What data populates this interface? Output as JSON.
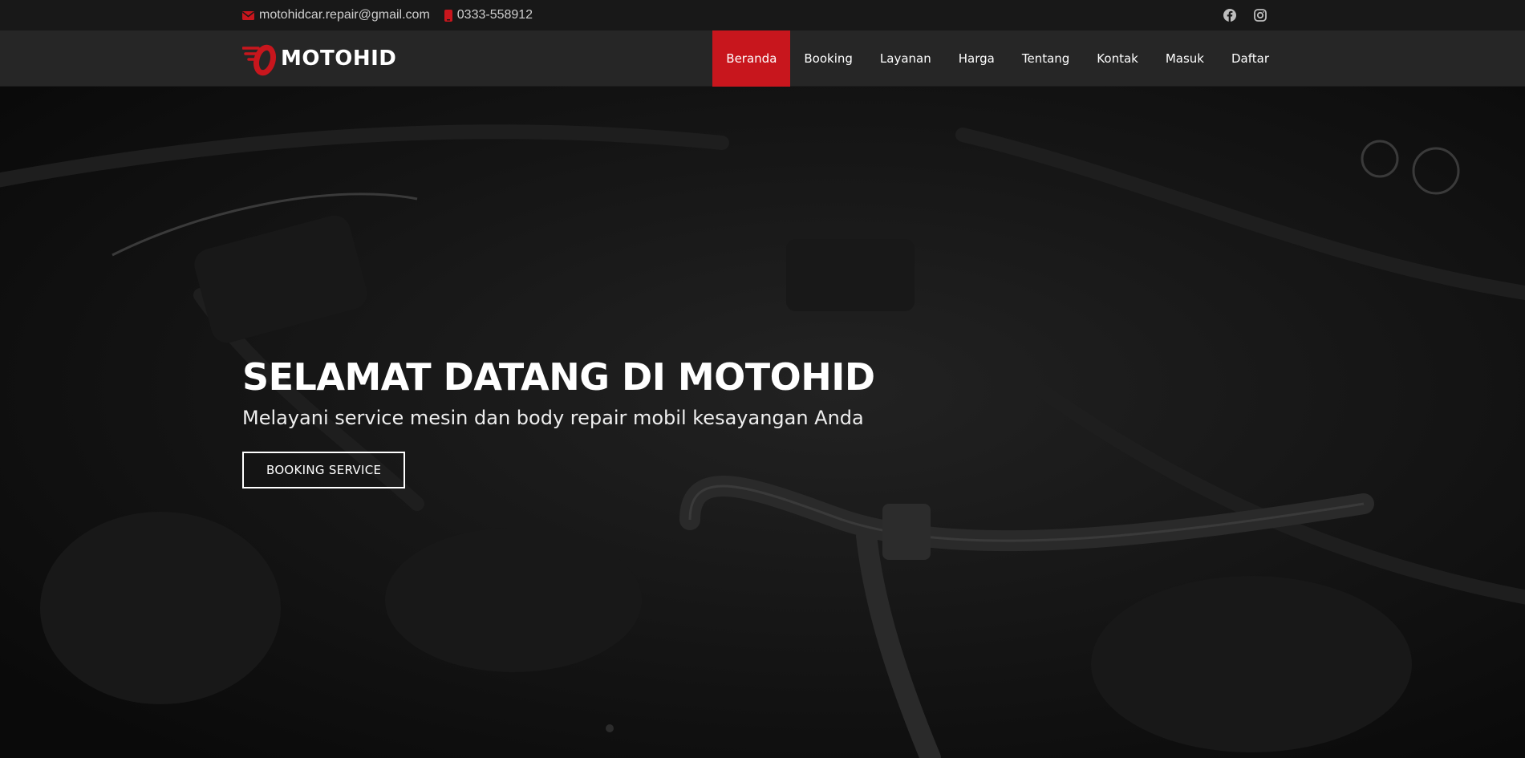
{
  "topbar": {
    "email": "motohidcar.repair@gmail.com",
    "phone": "0333-558912",
    "social": [
      "facebook-icon",
      "instagram-icon"
    ]
  },
  "brand": {
    "name": "MOTOHID",
    "accent": "#c8161d"
  },
  "nav": {
    "items": [
      {
        "label": "Beranda",
        "active": true
      },
      {
        "label": "Booking"
      },
      {
        "label": "Layanan"
      },
      {
        "label": "Harga"
      },
      {
        "label": "Tentang"
      },
      {
        "label": "Kontak"
      },
      {
        "label": "Masuk"
      },
      {
        "label": "Daftar"
      }
    ]
  },
  "hero": {
    "title": "SELAMAT DATANG DI MOTOHID",
    "subtitle": "Melayani service mesin dan body repair mobil kesayangan Anda",
    "button": "BOOKING SERVICE"
  }
}
